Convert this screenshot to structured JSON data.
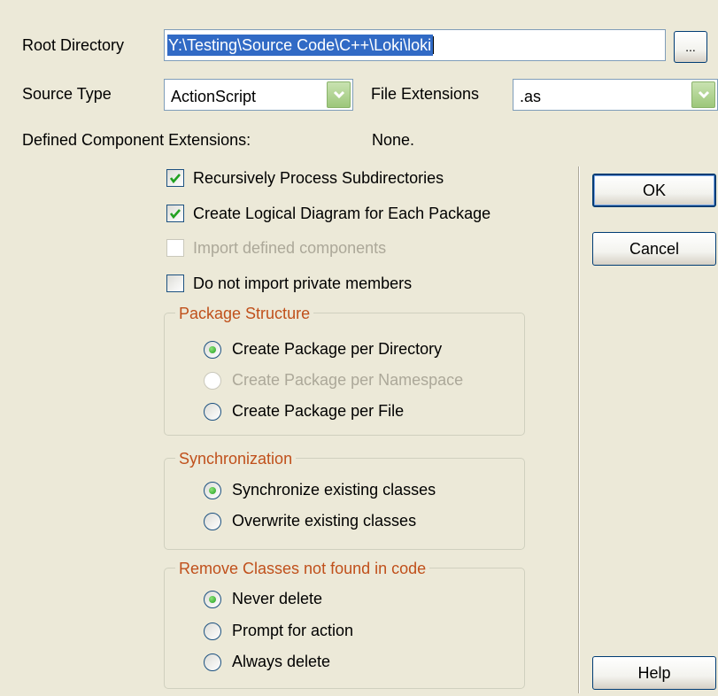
{
  "root_directory": {
    "label": "Root Directory",
    "value_selected": "Y:\\Testing\\Source Code\\C++\\Loki\\loki",
    "browse_label": "..."
  },
  "source_type": {
    "label": "Source Type",
    "value": "ActionScript"
  },
  "file_extensions": {
    "label": "File Extensions",
    "value": ".as"
  },
  "defined_component_extensions": {
    "label": "Defined Component Extensions:",
    "value": "None."
  },
  "options": {
    "recursive": {
      "label": "Recursively Process Subdirectories",
      "checked": true,
      "enabled": true
    },
    "logical_diagram": {
      "label": "Create Logical Diagram for Each Package",
      "checked": true,
      "enabled": true
    },
    "import_components": {
      "label": "Import defined components",
      "checked": false,
      "enabled": false
    },
    "no_private": {
      "label": "Do not import private members",
      "checked": false,
      "enabled": true
    }
  },
  "package_structure": {
    "title": "Package Structure",
    "options": [
      {
        "label": "Create Package per Directory",
        "selected": true,
        "enabled": true
      },
      {
        "label": "Create Package per Namespace",
        "selected": false,
        "enabled": false
      },
      {
        "label": "Create Package per File",
        "selected": false,
        "enabled": true
      }
    ]
  },
  "synchronization": {
    "title": "Synchronization",
    "options": [
      {
        "label": "Synchronize existing classes",
        "selected": true
      },
      {
        "label": "Overwrite existing classes",
        "selected": false
      }
    ]
  },
  "remove_classes": {
    "title": "Remove Classes not found in code",
    "options": [
      {
        "label": "Never delete",
        "selected": true
      },
      {
        "label": "Prompt for action",
        "selected": false
      },
      {
        "label": "Always delete",
        "selected": false
      }
    ]
  },
  "buttons": {
    "ok": "OK",
    "cancel": "Cancel",
    "help": "Help"
  },
  "colors": {
    "dialog_bg": "#ece9d8",
    "group_title": "#c0501b",
    "selection": "#316ac5",
    "check_green": "#21a121"
  }
}
